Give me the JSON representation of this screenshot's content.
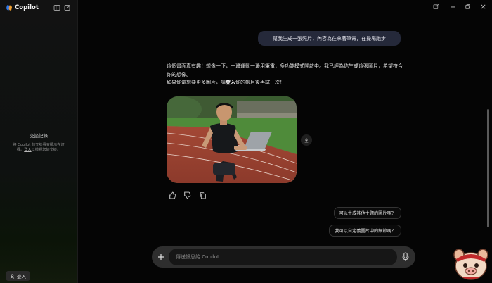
{
  "app": {
    "name": "Copilot"
  },
  "sidebar": {
    "history_title": "交談記錄",
    "history_desc_pre": "將 Copilot 的交談看會顯示在這裡。",
    "history_desc_link": "登入",
    "history_desc_post": "以檢視您的交談。",
    "signin_label": "登入"
  },
  "chat": {
    "user_message": "幫我生成一張照片，內容為在拿著筆電，在操場跑步",
    "reply_line1": "這個畫面真有趣！想像一下，一邊運動一邊用筆電，多功能模式開啟中。我已經為你生成這張圖片，希望符合你的想像。",
    "reply_line2_pre": "如果你還想要更多圖片，請",
    "reply_line2_link": "登入",
    "reply_line2_post": "你的帳戶後再試一次！",
    "suggestions": [
      "可以生成其他主題的圖片嗎？",
      "我可以自定義圖片中的細節嗎？"
    ]
  },
  "composer": {
    "placeholder": "傳送訊息給 Copilot"
  },
  "icons": {
    "brand": "copilot-logo",
    "sidebar": [
      "sidebar-toggle-icon",
      "new-chat-icon"
    ],
    "window": [
      "edit-icon",
      "minimize-icon",
      "restore-icon",
      "close-icon"
    ],
    "message_actions": [
      "thumbs-up-icon",
      "thumbs-down-icon",
      "copy-icon"
    ],
    "download": "download-icon",
    "composer": [
      "plus-icon",
      "microphone-icon"
    ]
  },
  "colors": {
    "background": "#050505",
    "user_bubble": "#25293a",
    "composer": "#2e2e2e",
    "track_red": "#b24a38",
    "grass_green": "#4f8b3a"
  }
}
